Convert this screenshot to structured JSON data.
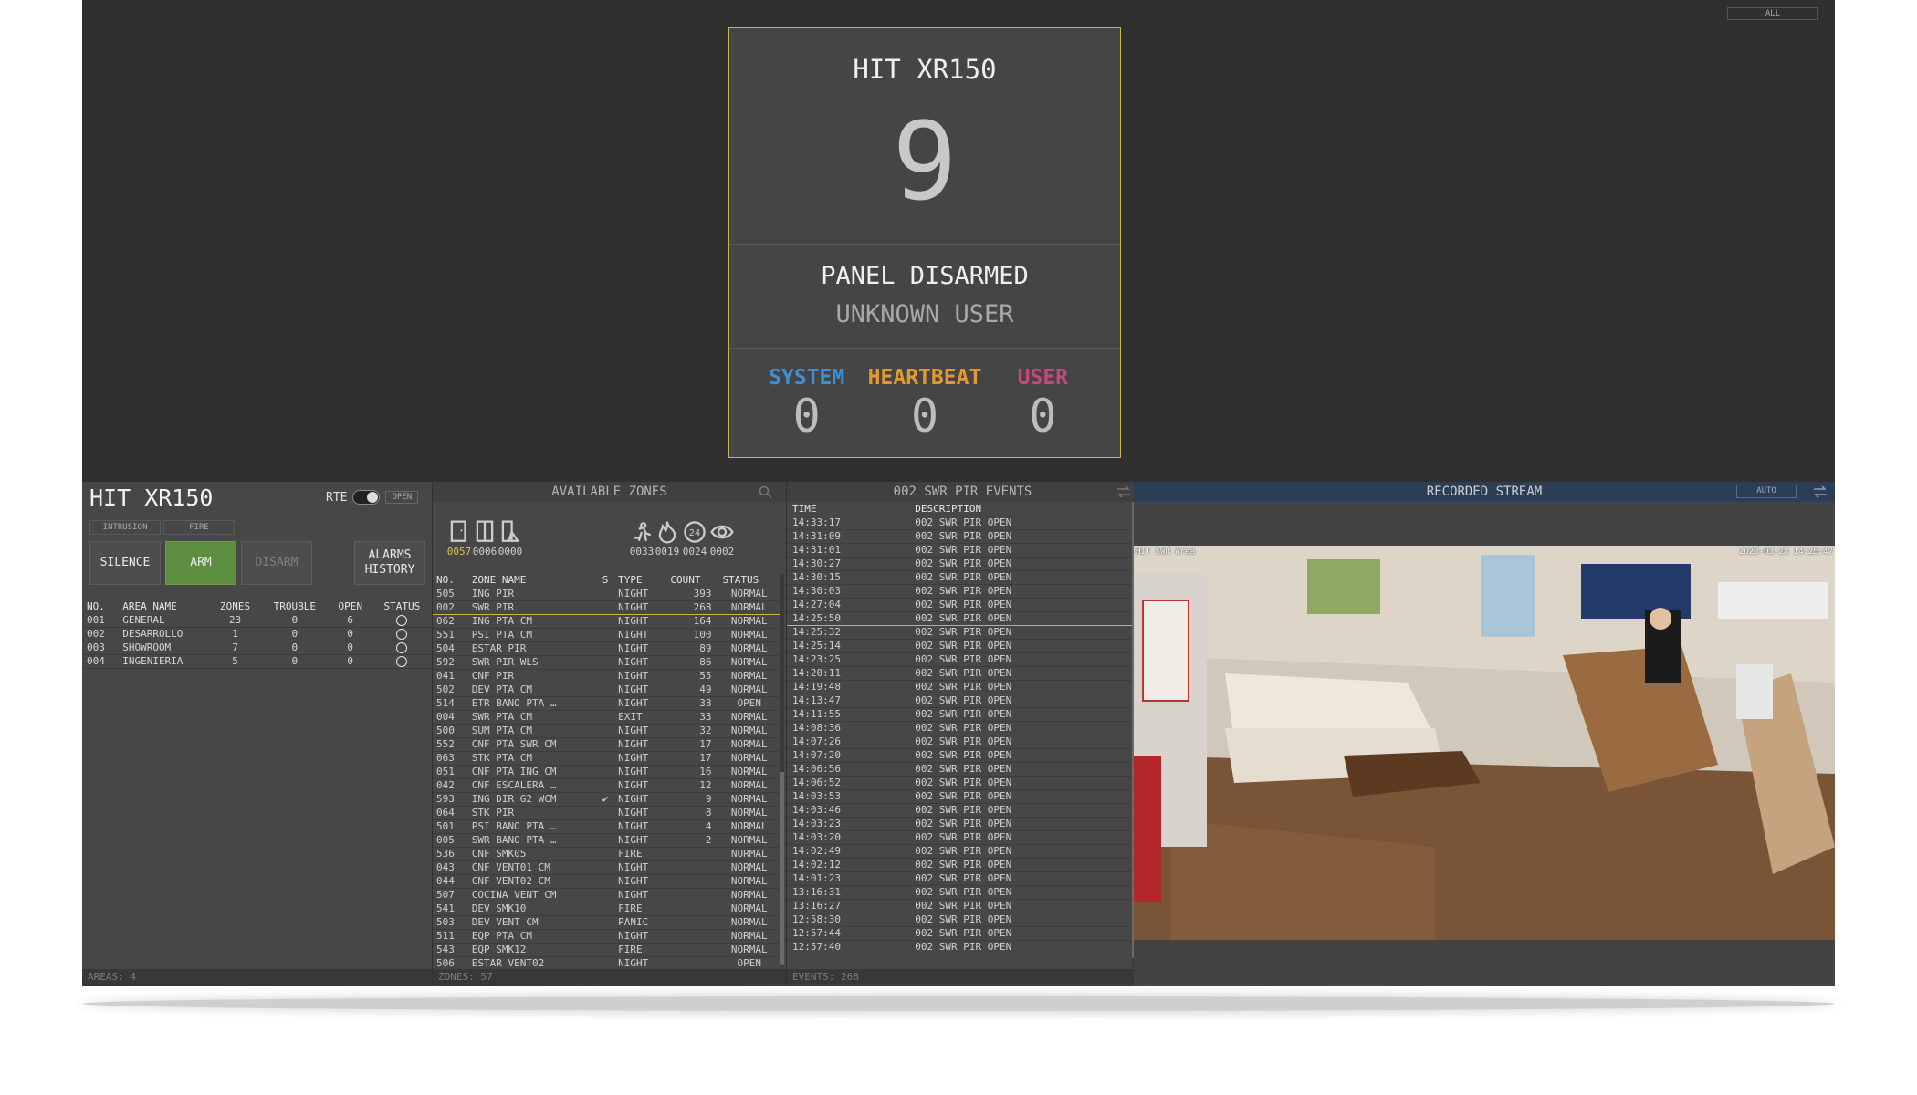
{
  "top": {
    "all_label": "ALL"
  },
  "hero": {
    "title": "HIT XR150",
    "count": "9",
    "state": "PANEL DISARMED",
    "user": "UNKNOWN USER",
    "stats": [
      {
        "label": "SYSTEM",
        "value": "0",
        "color": "#3f8fd6"
      },
      {
        "label": "HEARTBEAT",
        "value": "0",
        "color": "#e39a2d"
      },
      {
        "label": "USER",
        "value": "0",
        "color": "#c8477a"
      }
    ]
  },
  "area_panel": {
    "title": "HIT XR150",
    "rte_label": "RTE",
    "open_label": "OPEN",
    "tabs": [
      "INTRUSION",
      "FIRE"
    ],
    "buttons": {
      "silence": "SILENCE",
      "arm": "ARM",
      "disarm": "DISARM",
      "history_line1": "ALARMS",
      "history_line2": "HISTORY"
    },
    "columns": [
      "NO.",
      "AREA NAME",
      "ZONES",
      "TROUBLE",
      "OPEN",
      "STATUS"
    ],
    "rows": [
      [
        "001",
        "GENERAL",
        "23",
        "0",
        "6"
      ],
      [
        "002",
        "DESARROLLO",
        "1",
        "0",
        "0"
      ],
      [
        "003",
        "SHOWROOM",
        "7",
        "0",
        "0"
      ],
      [
        "004",
        "INGENIERIA",
        "5",
        "0",
        "0"
      ]
    ],
    "footer": "AREAS: 4"
  },
  "zones_panel": {
    "header": "AVAILABLE ZONES",
    "icons": [
      {
        "name": "door-icon",
        "count": "0057"
      },
      {
        "name": "window-icon",
        "count": "0006"
      },
      {
        "name": "glass-break-icon",
        "count": "0000"
      },
      {
        "name": "motion-icon",
        "count": "0033"
      },
      {
        "name": "fire-icon",
        "count": "0019"
      },
      {
        "name": "24h-icon",
        "count": "0024"
      },
      {
        "name": "eye-icon",
        "count": "0002"
      }
    ],
    "columns": [
      "NO.",
      "ZONE NAME",
      "S",
      "TYPE",
      "COUNT",
      "STATUS"
    ],
    "rows": [
      [
        "505",
        "ING PIR",
        "",
        "NIGHT",
        "393",
        "NORMAL"
      ],
      [
        "002",
        "SWR PIR",
        "",
        "NIGHT",
        "268",
        "NORMAL"
      ],
      [
        "062",
        "ING PTA CM",
        "",
        "NIGHT",
        "164",
        "NORMAL"
      ],
      [
        "551",
        "PSI PTA CM",
        "",
        "NIGHT",
        "100",
        "NORMAL"
      ],
      [
        "504",
        "ESTAR PIR",
        "",
        "NIGHT",
        "89",
        "NORMAL"
      ],
      [
        "592",
        "SWR PIR WLS",
        "",
        "NIGHT",
        "86",
        "NORMAL"
      ],
      [
        "041",
        "CNF PIR",
        "",
        "NIGHT",
        "55",
        "NORMAL"
      ],
      [
        "502",
        "DEV PTA CM",
        "",
        "NIGHT",
        "49",
        "NORMAL"
      ],
      [
        "514",
        "ETR BANO PTA …",
        "",
        "NIGHT",
        "38",
        "OPEN"
      ],
      [
        "004",
        "SWR PTA CM",
        "",
        "EXIT",
        "33",
        "NORMAL"
      ],
      [
        "500",
        "SUM PTA CM",
        "",
        "NIGHT",
        "32",
        "NORMAL"
      ],
      [
        "552",
        "CNF PTA SWR CM",
        "",
        "NIGHT",
        "17",
        "NORMAL"
      ],
      [
        "063",
        "STK PTA CM",
        "",
        "NIGHT",
        "17",
        "NORMAL"
      ],
      [
        "051",
        "CNF PTA ING CM",
        "",
        "NIGHT",
        "16",
        "NORMAL"
      ],
      [
        "042",
        "CNF ESCALERA …",
        "",
        "NIGHT",
        "12",
        "NORMAL"
      ],
      [
        "593",
        "ING DIR G2 WCM",
        "✔",
        "NIGHT",
        "9",
        "NORMAL"
      ],
      [
        "064",
        "STK PIR",
        "",
        "NIGHT",
        "8",
        "NORMAL"
      ],
      [
        "501",
        "PSI BANO PTA …",
        "",
        "NIGHT",
        "4",
        "NORMAL"
      ],
      [
        "005",
        "SWR BANO PTA …",
        "",
        "NIGHT",
        "2",
        "NORMAL"
      ],
      [
        "536",
        "CNF SMK05",
        "",
        "FIRE",
        "",
        "NORMAL"
      ],
      [
        "043",
        "CNF VENT01 CM",
        "",
        "NIGHT",
        "",
        "NORMAL"
      ],
      [
        "044",
        "CNF VENT02 CM",
        "",
        "NIGHT",
        "",
        "NORMAL"
      ],
      [
        "507",
        "COCINA VENT CM",
        "",
        "NIGHT",
        "",
        "NORMAL"
      ],
      [
        "541",
        "DEV SMK10",
        "",
        "FIRE",
        "",
        "NORMAL"
      ],
      [
        "503",
        "DEV VENT CM",
        "",
        "PANIC",
        "",
        "NORMAL"
      ],
      [
        "511",
        "EQP PTA CM",
        "",
        "NIGHT",
        "",
        "NORMAL"
      ],
      [
        "543",
        "EQP SMK12",
        "",
        "FIRE",
        "",
        "NORMAL"
      ],
      [
        "506",
        "ESTAR VENT02",
        "",
        "NIGHT",
        "",
        "OPEN"
      ]
    ],
    "footer": "ZONES: 57"
  },
  "events_panel": {
    "header": "002 SWR PIR EVENTS",
    "columns": [
      "TIME",
      "DESCRIPTION"
    ],
    "rows": [
      [
        "14:33:17",
        "002 SWR PIR OPEN"
      ],
      [
        "14:31:09",
        "002 SWR PIR OPEN"
      ],
      [
        "14:31:01",
        "002 SWR PIR OPEN"
      ],
      [
        "14:30:27",
        "002 SWR PIR OPEN"
      ],
      [
        "14:30:15",
        "002 SWR PIR OPEN"
      ],
      [
        "14:30:03",
        "002 SWR PIR OPEN"
      ],
      [
        "14:27:04",
        "002 SWR PIR OPEN"
      ],
      [
        "14:25:50",
        "002 SWR PIR OPEN"
      ],
      [
        "14:25:32",
        "002 SWR PIR OPEN"
      ],
      [
        "14:25:14",
        "002 SWR PIR OPEN"
      ],
      [
        "14:23:25",
        "002 SWR PIR OPEN"
      ],
      [
        "14:20:11",
        "002 SWR PIR OPEN"
      ],
      [
        "14:19:48",
        "002 SWR PIR OPEN"
      ],
      [
        "14:13:47",
        "002 SWR PIR OPEN"
      ],
      [
        "14:11:55",
        "002 SWR PIR OPEN"
      ],
      [
        "14:08:36",
        "002 SWR PIR OPEN"
      ],
      [
        "14:07:26",
        "002 SWR PIR OPEN"
      ],
      [
        "14:07:20",
        "002 SWR PIR OPEN"
      ],
      [
        "14:06:56",
        "002 SWR PIR OPEN"
      ],
      [
        "14:06:52",
        "002 SWR PIR OPEN"
      ],
      [
        "14:03:53",
        "002 SWR PIR OPEN"
      ],
      [
        "14:03:46",
        "002 SWR PIR OPEN"
      ],
      [
        "14:03:23",
        "002 SWR PIR OPEN"
      ],
      [
        "14:03:20",
        "002 SWR PIR OPEN"
      ],
      [
        "14:02:49",
        "002 SWR PIR OPEN"
      ],
      [
        "14:02:12",
        "002 SWR PIR OPEN"
      ],
      [
        "14:01:23",
        "002 SWR PIR OPEN"
      ],
      [
        "13:16:31",
        "002 SWR PIR OPEN"
      ],
      [
        "13:16:27",
        "002 SWR PIR OPEN"
      ],
      [
        "12:58:30",
        "002 SWR PIR OPEN"
      ],
      [
        "12:57:44",
        "002 SWR PIR OPEN"
      ],
      [
        "12:57:40",
        "002 SWR PIR OPEN"
      ]
    ],
    "footer": "EVENTS: 268"
  },
  "stream_panel": {
    "header": "RECORDED STREAM",
    "auto_label": "AUTO",
    "camera_label": "HIT SWR Area",
    "timestamp": "2023-03-28 14:25:47"
  }
}
